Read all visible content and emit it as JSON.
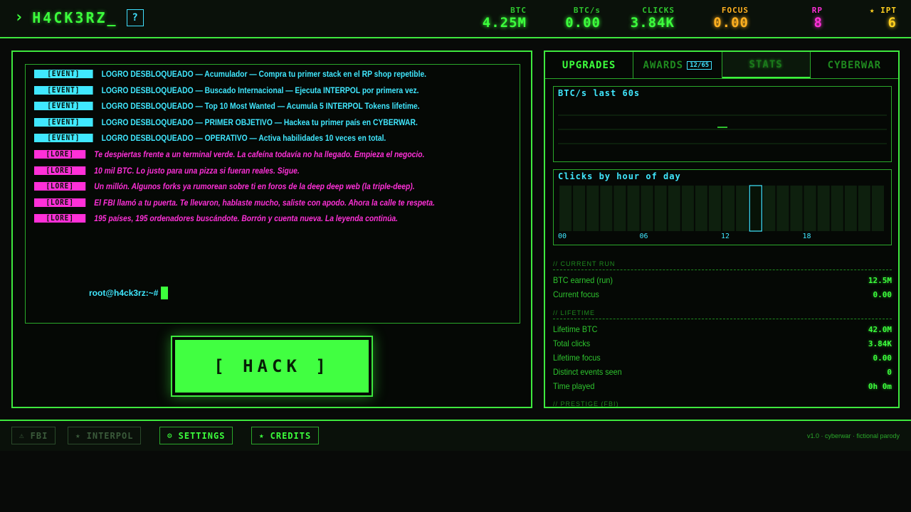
{
  "header": {
    "chevron": "›",
    "brand": "H4CK3RZ_",
    "help": "?",
    "stats": [
      {
        "label": "BTC",
        "value": "4.25M",
        "color": "#3cff3c"
      },
      {
        "label": "BTC/s",
        "value": "0.00",
        "color": "#3cff3c"
      },
      {
        "label": "CLICKS",
        "value": "3.84K",
        "color": "#3cff3c"
      },
      {
        "label": "FOCUS",
        "value": "0.00",
        "color": "#ffb020"
      },
      {
        "label": "RP",
        "value": "8",
        "color": "#ff30d8"
      },
      {
        "label": "★ IPT",
        "value": "6",
        "color": "#ffd020"
      }
    ]
  },
  "terminal": {
    "lines": [
      {
        "tag": "[EVENT]",
        "type": "event",
        "text": "LOGRO DESBLOQUEADO — Acumulador — Compra tu primer stack en el RP shop repetible."
      },
      {
        "tag": "[EVENT]",
        "type": "event",
        "text": "LOGRO DESBLOQUEADO — Buscado Internacional — Ejecuta INTERPOL por primera vez."
      },
      {
        "tag": "[EVENT]",
        "type": "event",
        "text": "LOGRO DESBLOQUEADO — Top 10 Most Wanted — Acumula 5 INTERPOL Tokens lifetime."
      },
      {
        "tag": "[EVENT]",
        "type": "event",
        "text": "LOGRO DESBLOQUEADO — PRIMER OBJETIVO — Hackea tu primer país en CYBERWAR."
      },
      {
        "tag": "[EVENT]",
        "type": "event",
        "text": "LOGRO DESBLOQUEADO — OPERATIVO — Activa habilidades 10 veces en total."
      },
      {
        "tag": "[LORE]",
        "type": "lore",
        "text": "Te despiertas frente a un terminal verde. La cafeína todavía no ha llegado. Empieza el negocio."
      },
      {
        "tag": "[LORE]",
        "type": "lore",
        "text": "10 mil BTC. Lo justo para una pizza si fueran reales. Sigue."
      },
      {
        "tag": "[LORE]",
        "type": "lore",
        "text": "Un millón. Algunos forks ya rumorean sobre ti en foros de la deep deep web (la triple-deep)."
      },
      {
        "tag": "[LORE]",
        "type": "lore",
        "text": "El FBI llamó a tu puerta. Te llevaron, hablaste mucho, saliste con apodo. Ahora la calle te respeta."
      },
      {
        "tag": "[LORE]",
        "type": "lore",
        "text": "195 países, 195 ordenadores buscándote. Borrón y cuenta nueva. La leyenda continúa."
      }
    ],
    "prompt": "root@h4ck3rz:~#"
  },
  "hack_button": "[ HACK ]",
  "tabs": [
    {
      "label": "UPGRADES",
      "state": "normal"
    },
    {
      "label": "AWARDS",
      "badge": "12/65",
      "state": "dim"
    },
    {
      "label": "STATS",
      "state": "active"
    },
    {
      "label": "CYBERWAR",
      "state": "dim"
    }
  ],
  "chart_data": [
    {
      "type": "line",
      "title": "BTC/s last 60s",
      "series": [
        {
          "values": [
            0,
            0
          ]
        }
      ]
    },
    {
      "type": "bar",
      "title": "Clicks by hour of day",
      "x_tick_labels": [
        "00",
        "06",
        "12",
        "18"
      ],
      "highlight_hour": 14,
      "values": [
        0,
        0,
        0,
        0,
        0,
        0,
        0,
        0,
        0,
        0,
        0,
        0,
        0,
        0,
        1,
        0,
        0,
        0,
        0,
        0,
        0,
        0,
        0,
        0
      ]
    }
  ],
  "stats": {
    "current_run": {
      "heading": "// CURRENT RUN",
      "rows": [
        {
          "k": "BTC earned (run)",
          "v": "12.5M"
        },
        {
          "k": "Current focus",
          "v": "0.00"
        }
      ]
    },
    "lifetime": {
      "heading": "// LIFETIME",
      "rows": [
        {
          "k": "Lifetime BTC",
          "v": "42.0M"
        },
        {
          "k": "Total clicks",
          "v": "3.84K"
        },
        {
          "k": "Lifetime focus",
          "v": "0.00"
        },
        {
          "k": "Distinct events seen",
          "v": "0"
        },
        {
          "k": "Time played",
          "v": "0h 0m"
        }
      ]
    },
    "prestige": {
      "heading": "// PRESTIGE (FBI)"
    }
  },
  "footer": {
    "buttons": [
      {
        "icon": "⚠",
        "label": "FBI",
        "enabled": false
      },
      {
        "icon": "★",
        "label": "INTERPOL",
        "enabled": false
      },
      {
        "icon": "⚙",
        "label": "SETTINGS",
        "enabled": true
      },
      {
        "icon": "★",
        "label": "CREDITS",
        "enabled": true
      }
    ],
    "version": "v1.0 · cyberwar · fictional parody"
  },
  "colors": {
    "accent": "#3cff3c",
    "cyan": "#40e8ff",
    "magenta": "#ff30d8",
    "amber": "#ffb020",
    "yellow": "#ffd020"
  }
}
